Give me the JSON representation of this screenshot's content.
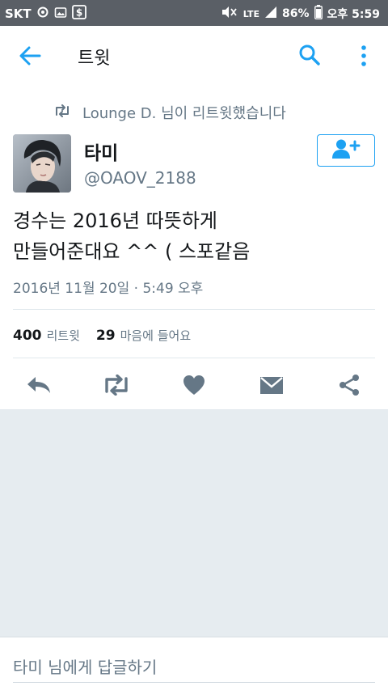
{
  "status_bar": {
    "carrier": "SKT",
    "network": "LTE",
    "battery": "86%",
    "time": "오후 5:59",
    "icons": [
      "settings-icon",
      "gallery-icon",
      "s-app-icon",
      "mute-icon",
      "signal-icon",
      "battery-icon"
    ]
  },
  "app_bar": {
    "title": "트윗",
    "icons": [
      "back-arrow-icon",
      "search-icon",
      "more-vertical-icon"
    ]
  },
  "tweet": {
    "retweeted_by": "Lounge D. 님이 리트윗했습니다",
    "author_name": "타미",
    "author_handle": "@OAOV_2188",
    "text_line1": "경수는 2016년 따뜻하게",
    "text_line2": "만들어준대요 ^^ ( 스포같음",
    "timestamp": "2016년 11월 20일 · 5:49 오후",
    "retweet_count": "400",
    "retweet_label": "리트윗",
    "like_count": "29",
    "like_label": "마음에 들어요",
    "actions": [
      "reply-icon",
      "retweet-icon",
      "heart-icon",
      "message-icon",
      "share-icon"
    ]
  },
  "reply": {
    "placeholder": "타미 님에게 답글하기"
  },
  "colors": {
    "accent": "#1da1f2",
    "icon_gray": "#657786",
    "background": "#e6ecf0",
    "status_bar": "#5a5f66"
  }
}
